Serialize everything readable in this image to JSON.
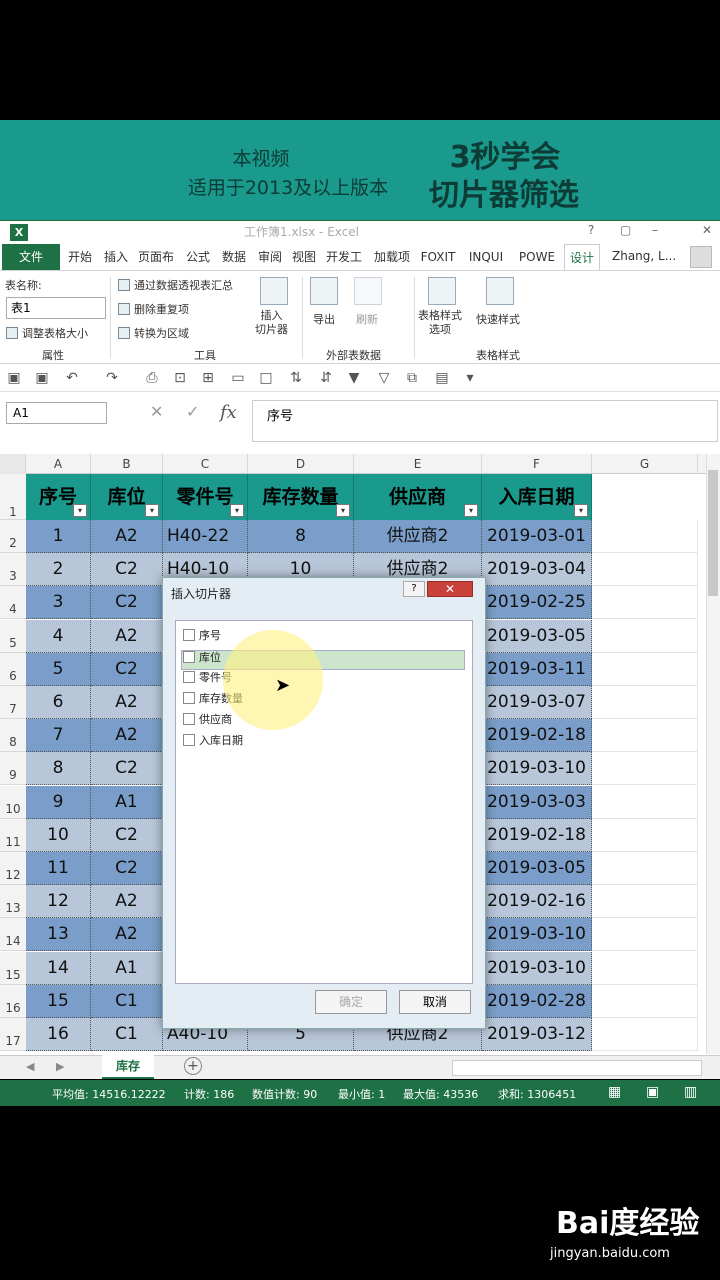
{
  "banner": {
    "line1": "本视频",
    "line2": "适用于2013及以上版本",
    "title1": "3秒学会",
    "title2": "切片器筛选"
  },
  "titlebar": {
    "title": "工作簿1.xlsx - Excel",
    "help": "?",
    "restore": "▢",
    "minimize": "–",
    "close": "✕"
  },
  "tabs": [
    "文件",
    "开始",
    "插入",
    "页面布",
    "公式",
    "数据",
    "审阅",
    "视图",
    "开发工",
    "加载项",
    "FOXIT",
    "INQUI",
    "POWE",
    "设计"
  ],
  "user": "Zhang, L...",
  "ribbon": {
    "table_name_label": "表名称:",
    "table_name": "表1",
    "resize": "调整表格大小",
    "props_group": "属性",
    "tool1": "通过数据透视表汇总",
    "tool2": "删除重复项",
    "tool3": "转换为区域",
    "slicer": "插入\n切片器",
    "tools_group": "工具",
    "export": "导出",
    "refresh": "刷新",
    "ext_group": "外部表数据",
    "style_opts": "表格样式\n选项",
    "quick_style": "快速样式",
    "style_group": "表格样式"
  },
  "formula": {
    "namebox": "A1",
    "content": "序号",
    "fx": "fx"
  },
  "columns": [
    "A",
    "B",
    "C",
    "D",
    "E",
    "F",
    "G"
  ],
  "headers": [
    "序号",
    "库位",
    "零件号",
    "库存数量",
    "供应商",
    "入库日期"
  ],
  "rows": [
    [
      "1",
      "A2",
      "H40-22",
      "8",
      "供应商2",
      "2019-03-01"
    ],
    [
      "2",
      "C2",
      "H40-10",
      "10",
      "供应商2",
      "2019-03-04"
    ],
    [
      "3",
      "C2",
      "",
      "",
      "",
      "2019-02-25"
    ],
    [
      "4",
      "A2",
      "",
      "",
      "",
      "2019-03-05"
    ],
    [
      "5",
      "C2",
      "",
      "",
      "",
      "2019-03-11"
    ],
    [
      "6",
      "A2",
      "",
      "",
      "",
      "2019-03-07"
    ],
    [
      "7",
      "A2",
      "",
      "",
      "",
      "2019-02-18"
    ],
    [
      "8",
      "C2",
      "",
      "",
      "",
      "2019-03-10"
    ],
    [
      "9",
      "A1",
      "",
      "",
      "",
      "2019-03-03"
    ],
    [
      "10",
      "C2",
      "",
      "",
      "",
      "2019-02-18"
    ],
    [
      "11",
      "C2",
      "",
      "",
      "",
      "2019-03-05"
    ],
    [
      "12",
      "A2",
      "",
      "",
      "",
      "2019-02-16"
    ],
    [
      "13",
      "A2",
      "",
      "",
      "",
      "2019-03-10"
    ],
    [
      "14",
      "A1",
      "",
      "",
      "",
      "2019-03-10"
    ],
    [
      "15",
      "C1",
      "",
      "",
      "",
      "2019-02-28"
    ],
    [
      "16",
      "C1",
      "A40-10",
      "5",
      "供应商2",
      "2019-03-12"
    ]
  ],
  "dialog": {
    "title": "插入切片器",
    "options": [
      "序号",
      "库位",
      "零件号",
      "库存数量",
      "供应商",
      "入库日期"
    ],
    "ok": "确定",
    "cancel": "取消"
  },
  "sheet_tab": "库存",
  "status": {
    "avg": "平均值: 14516.12222",
    "count": "计数: 186",
    "numcount": "数值计数: 90",
    "min": "最小值: 1",
    "max": "最大值: 43536",
    "sum": "求和: 1306451"
  },
  "watermark": {
    "brand": "Bai度经验",
    "url": "jingyan.baidu.com"
  }
}
